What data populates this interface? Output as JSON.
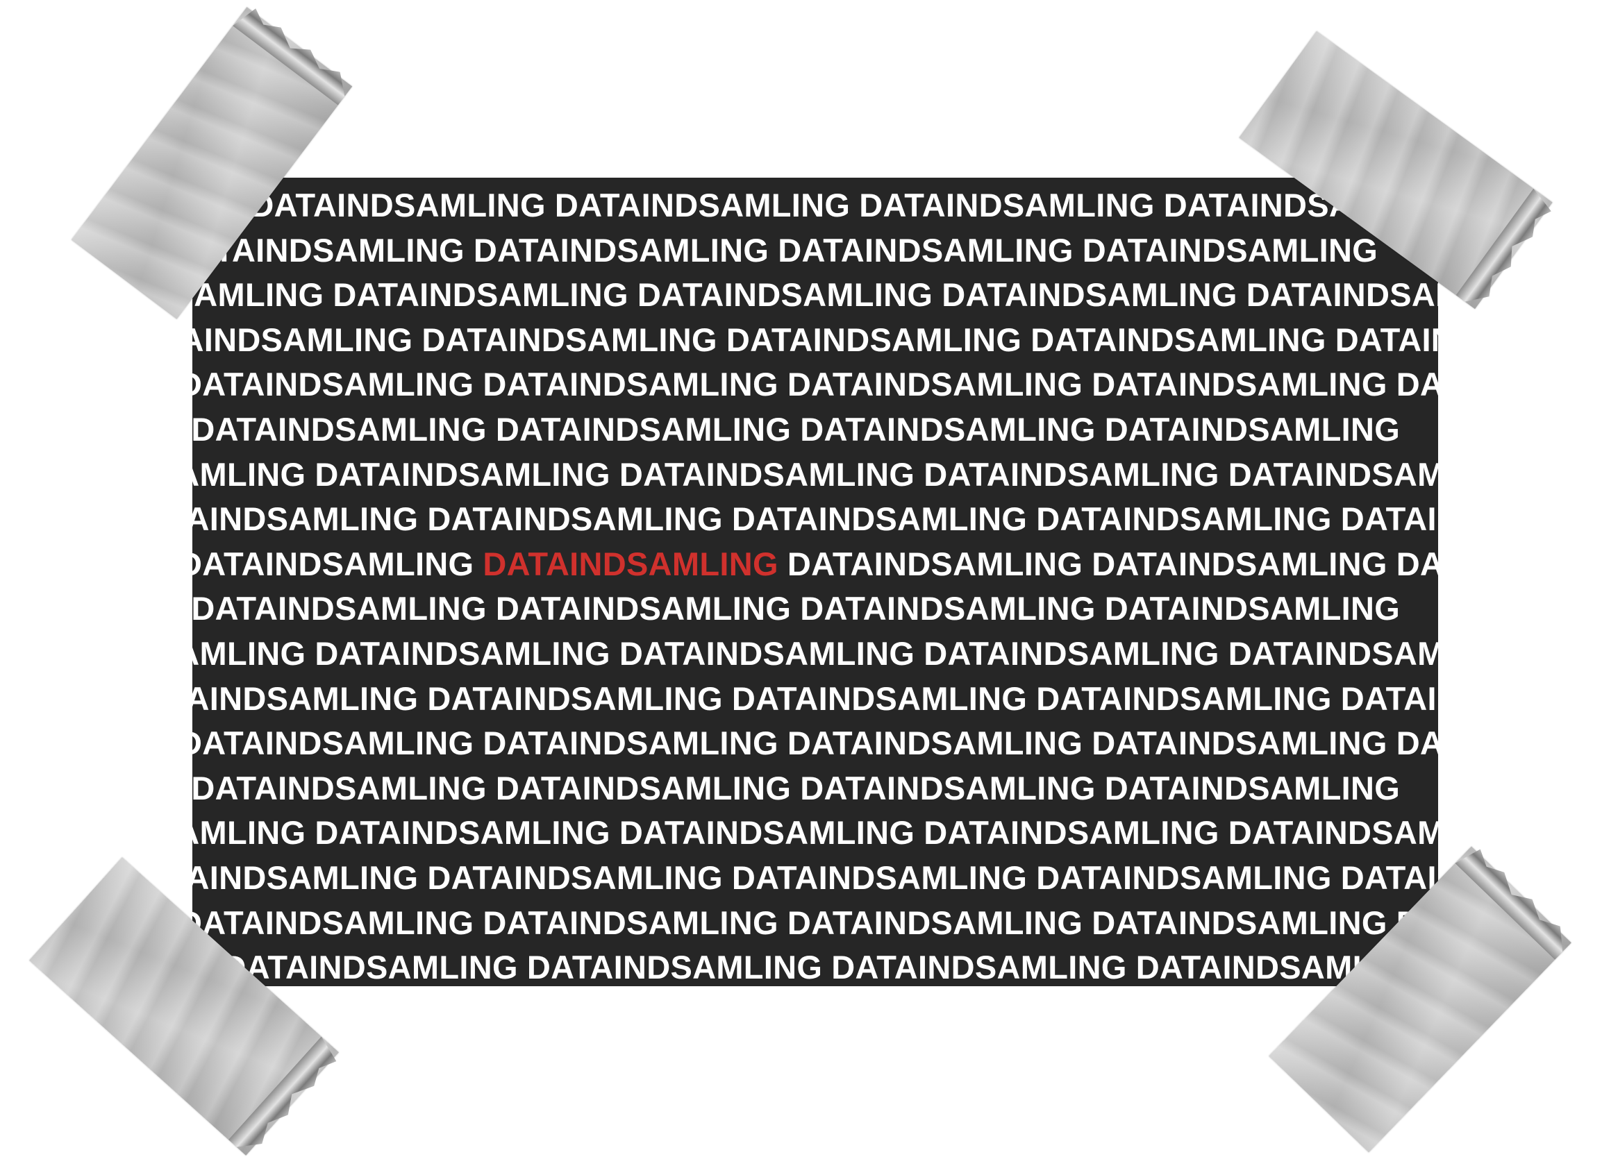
{
  "poster": {
    "word": "DATAINDSAMLING",
    "highlight_word": "DATAINDSAMLING",
    "background_color": "#262626",
    "text_color": "#ffffff",
    "highlight_color": "#d0312d",
    "highlight_row": 8,
    "highlight_position": 1
  },
  "tape": {
    "color": "#c4c4c4",
    "pieces": [
      "tape-top-left",
      "tape-top-right",
      "tape-bottom-left",
      "tape-bottom-right"
    ]
  }
}
